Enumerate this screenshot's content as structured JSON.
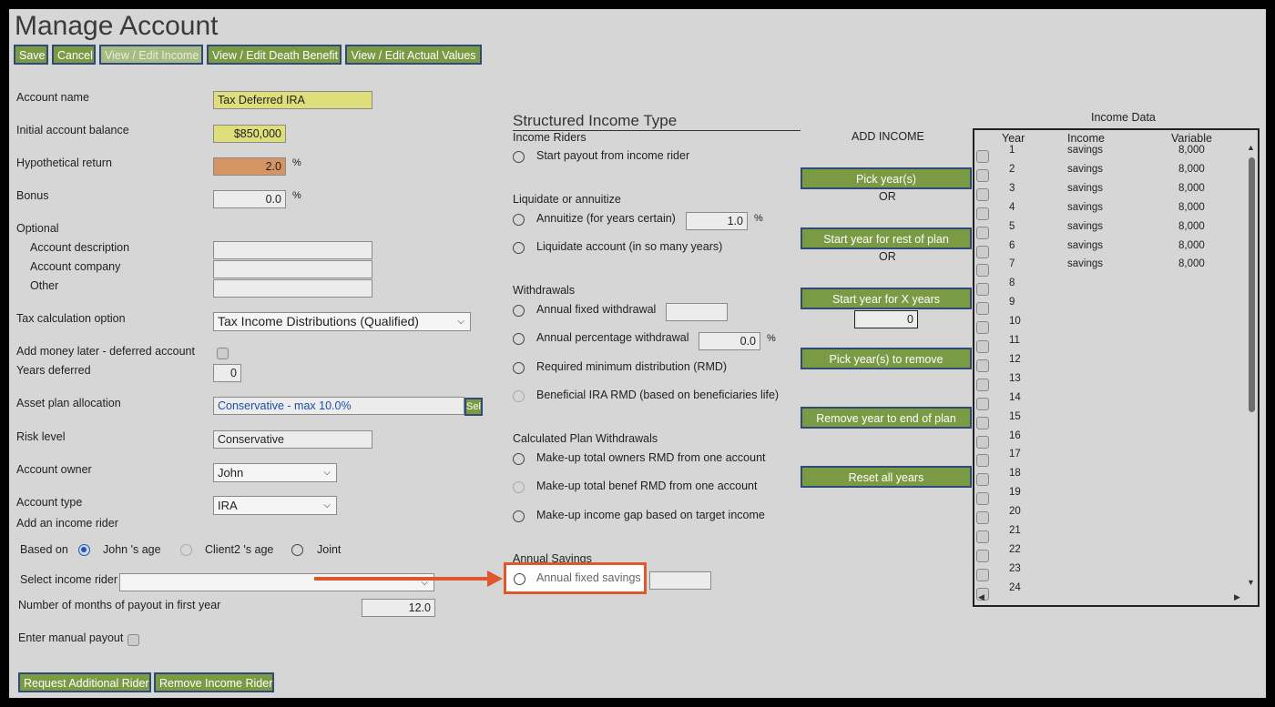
{
  "page": {
    "title": "Manage Account"
  },
  "toolbar": {
    "save": "Save",
    "cancel": "Cancel",
    "view_edit_income": "View / Edit Income",
    "view_edit_death_benefit": "View / Edit Death Benefit",
    "view_edit_actual_values": "View / Edit Actual Values"
  },
  "form": {
    "account_name_label": "Account name",
    "account_name_value": "Tax Deferred IRA",
    "initial_balance_label": "Initial account balance",
    "initial_balance_value": "$850,000",
    "hypothetical_return_label": "Hypothetical return",
    "hypothetical_return_value": "2.0",
    "bonus_label": "Bonus",
    "bonus_value": "0.0",
    "percent": "%",
    "optional_label": "Optional",
    "account_description_label": "Account description",
    "account_company_label": "Account company",
    "other_label": "Other",
    "tax_calc_label": "Tax calculation option",
    "tax_calc_value": "Tax Income Distributions (Qualified)",
    "add_money_later_label": "Add money later - deferred account",
    "years_deferred_label": "Years deferred",
    "years_deferred_value": "0",
    "asset_plan_label": "Asset plan allocation",
    "asset_plan_value": "Conservative - max 10.0%",
    "asset_plan_button": "Sel",
    "risk_level_label": "Risk level",
    "risk_level_value": "Conservative",
    "account_owner_label": "Account owner",
    "account_owner_value": "John",
    "account_type_label": "Account type",
    "account_type_value": "IRA",
    "add_income_rider_label": "Add an income rider",
    "based_on_label": "Based on",
    "based_on_john": "John 's age",
    "based_on_client2": "Client2 's age",
    "based_on_joint": "Joint",
    "select_income_rider_label": "Select income rider",
    "months_payout_label": "Number of months of payout in first year",
    "months_payout_value": "12.0",
    "manual_payout_label": "Enter manual payout",
    "request_rider_button": "Request Additional Rider",
    "remove_rider_button": "Remove Income Rider"
  },
  "structured": {
    "title": "Structured Income Type",
    "income_riders_heading": "Income Riders",
    "start_payout": "Start payout from income rider",
    "liquidate_heading": "Liquidate or annuitize",
    "annuitize": "Annuitize (for years certain)",
    "annuitize_value": "1.0",
    "liquidate_account": "Liquidate account (in so many years)",
    "withdrawals_heading": "Withdrawals",
    "annual_fixed_withdrawal": "Annual fixed withdrawal",
    "annual_percentage_withdrawal": "Annual percentage withdrawal",
    "annual_percentage_value": "0.0",
    "rmd": "Required minimum distribution (RMD)",
    "beneficial_rmd": "Beneficial IRA RMD (based on beneficiaries life)",
    "calculated_heading": "Calculated Plan Withdrawals",
    "makeup_owners_rmd": "Make-up total owners RMD from one account",
    "makeup_benef_rmd": "Make-up total benef RMD from one account",
    "makeup_income_gap": "Make-up income gap based on target income",
    "annual_savings_heading": "Annual Savings",
    "annual_fixed_savings": "Annual fixed savings",
    "percent": "%"
  },
  "add_income": {
    "title": "ADD INCOME",
    "pick_years": "Pick year(s)",
    "or1": "OR",
    "start_year_rest": "Start year for rest of plan",
    "or2": "OR",
    "start_year_x": "Start year for X years",
    "x_years_value": "0",
    "pick_years_remove": "Pick year(s) to remove",
    "remove_year_end": "Remove year to end of plan",
    "reset_all": "Reset all years"
  },
  "income_data": {
    "title": "Income Data",
    "headers": {
      "year": "Year",
      "income": "Income",
      "variable": "Variable"
    },
    "rows": [
      {
        "year": "1",
        "income": "savings",
        "variable": "8,000"
      },
      {
        "year": "2",
        "income": "savings",
        "variable": "8,000"
      },
      {
        "year": "3",
        "income": "savings",
        "variable": "8,000"
      },
      {
        "year": "4",
        "income": "savings",
        "variable": "8,000"
      },
      {
        "year": "5",
        "income": "savings",
        "variable": "8,000"
      },
      {
        "year": "6",
        "income": "savings",
        "variable": "8,000"
      },
      {
        "year": "7",
        "income": "savings",
        "variable": "8,000"
      },
      {
        "year": "8",
        "income": "",
        "variable": ""
      },
      {
        "year": "9",
        "income": "",
        "variable": ""
      },
      {
        "year": "10",
        "income": "",
        "variable": ""
      },
      {
        "year": "11",
        "income": "",
        "variable": ""
      },
      {
        "year": "12",
        "income": "",
        "variable": ""
      },
      {
        "year": "13",
        "income": "",
        "variable": ""
      },
      {
        "year": "14",
        "income": "",
        "variable": ""
      },
      {
        "year": "15",
        "income": "",
        "variable": ""
      },
      {
        "year": "16",
        "income": "",
        "variable": ""
      },
      {
        "year": "17",
        "income": "",
        "variable": ""
      },
      {
        "year": "18",
        "income": "",
        "variable": ""
      },
      {
        "year": "19",
        "income": "",
        "variable": ""
      },
      {
        "year": "20",
        "income": "",
        "variable": ""
      },
      {
        "year": "21",
        "income": "",
        "variable": ""
      },
      {
        "year": "22",
        "income": "",
        "variable": ""
      },
      {
        "year": "23",
        "income": "",
        "variable": ""
      },
      {
        "year": "24",
        "income": "",
        "variable": ""
      }
    ]
  },
  "colors": {
    "button_green": "#7a9a44",
    "button_border": "#2f4a78",
    "highlight_yellow": "#dede7a",
    "return_orange": "#d49464",
    "callout_orange": "#e0572b"
  }
}
